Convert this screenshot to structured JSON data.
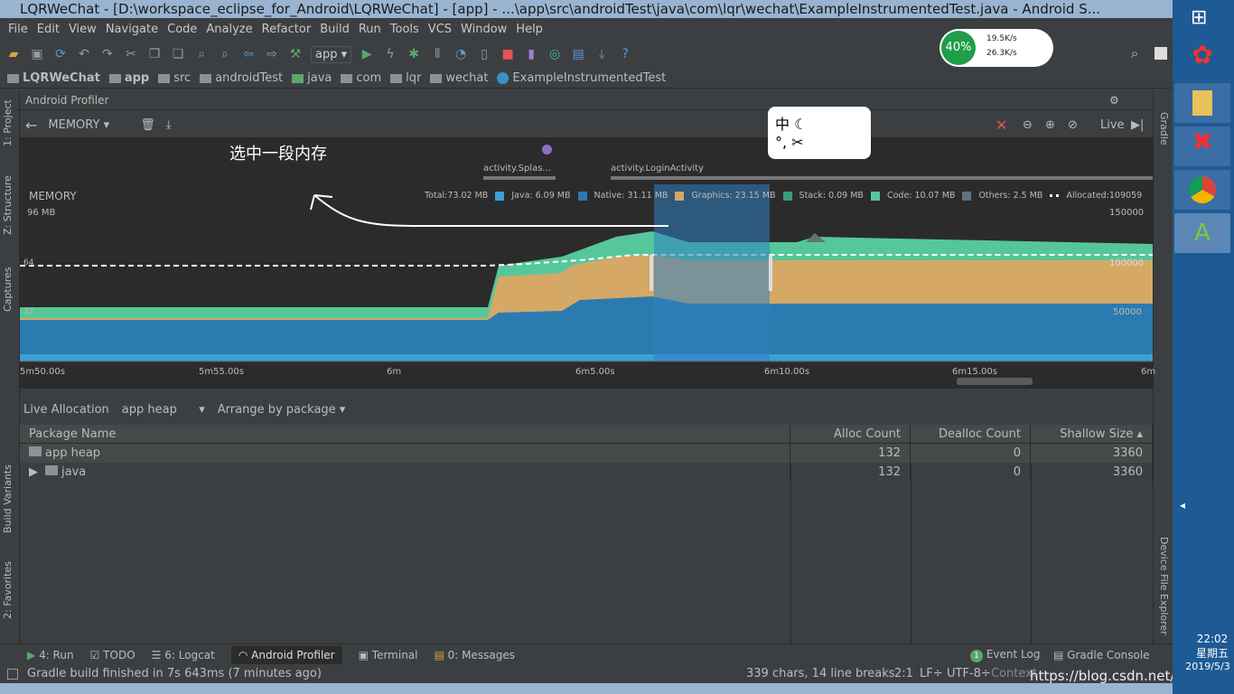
{
  "window": {
    "title": "LQRWeChat - [D:\\workspace_eclipse_for_Android\\LQRWeChat] - [app] - ...\\app\\src\\androidTest\\java\\com\\lqr\\wechat\\ExampleInstrumentedTest.java - Android S..."
  },
  "menu": [
    "File",
    "Edit",
    "View",
    "Navigate",
    "Code",
    "Analyze",
    "Refactor",
    "Build",
    "Run",
    "Tools",
    "VCS",
    "Window",
    "Help"
  ],
  "toolbar": {
    "config": "app"
  },
  "breadcrumbs": [
    "LQRWeChat",
    "app",
    "src",
    "androidTest",
    "java",
    "com",
    "lqr",
    "wechat",
    "ExampleInstrumentedTest"
  ],
  "net_widget": {
    "percent": "40%",
    "up": "19.5K/s",
    "down": "26.3K/s"
  },
  "left_tabs": [
    "1: Project",
    "Z: Structure",
    "Captures",
    "Build Variants",
    "2: Favorites"
  ],
  "right_tabs": [
    "Gradle",
    "Device File Explorer"
  ],
  "profiler": {
    "title": "Android Profiler",
    "monitor": "MEMORY",
    "live": "Live",
    "annotation": "选中一段内存",
    "activities": [
      "activity.Splas...",
      "activity.LoginActivity"
    ],
    "chart_label": "MEMORY",
    "y_left": [
      "96 MB",
      "64",
      "32"
    ],
    "y_right": [
      "150000",
      "100000",
      "50000"
    ],
    "legend": {
      "total": "Total:73.02 MB",
      "items": [
        {
          "label": "Java: 6.09 MB",
          "color": "#3d9fd6"
        },
        {
          "label": "Native: 31.11 MB",
          "color": "#2b7bb0"
        },
        {
          "label": "Graphics: 23.15 MB",
          "color": "#d5a866"
        },
        {
          "label": "Stack: 0.09 MB",
          "color": "#3a9c72"
        },
        {
          "label": "Code: 10.07 MB",
          "color": "#56c79a"
        },
        {
          "label": "Others:  2.5 MB",
          "color": "#5e7280"
        }
      ],
      "allocated": "Allocated:109059"
    },
    "time_ticks": [
      "5m50.00s",
      "5m55.00s",
      "6m",
      "6m5.00s",
      "6m10.00s",
      "6m15.00s",
      "6m"
    ]
  },
  "allocation": {
    "view": "Live Allocation",
    "heap": "app heap",
    "arrange": "Arrange by package",
    "columns": [
      "Package Name",
      "Alloc Count",
      "Dealloc Count",
      "Shallow Size ▴"
    ],
    "rows": [
      {
        "name": "app heap",
        "alloc": "132",
        "dealloc": "0",
        "size": "3360"
      },
      {
        "name": "java",
        "alloc": "132",
        "dealloc": "0",
        "size": "3360"
      }
    ]
  },
  "bottom_tools": [
    "4: Run",
    "TODO",
    "6: Logcat",
    "Android Profiler",
    "Terminal",
    "0: Messages"
  ],
  "bottom_right": [
    "Event Log",
    "Gradle Console"
  ],
  "event_badge": "1",
  "status": {
    "message": "Gradle build finished in 7s 643ms (7 minutes ago)",
    "chars": "339 chars, 14 line breaks",
    "pos": "2:1",
    "lf": "LF÷",
    "enc": "UTF-8÷",
    "context": "Context",
    "watermark": "https://blog.csdn.net/qq_"
  },
  "clock": {
    "time": "22:02",
    "day": "星期五",
    "date": "2019/5/3"
  }
}
